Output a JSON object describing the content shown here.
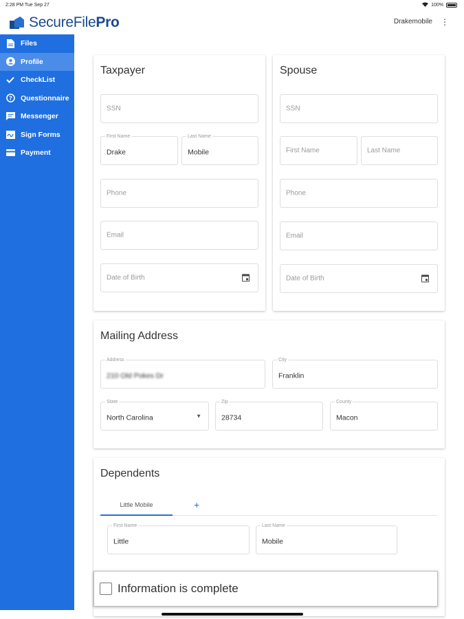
{
  "status_bar": {
    "time": "2:28 PM  Tue Sep 27",
    "battery": "100%"
  },
  "header": {
    "logo_main": "SecureFile",
    "logo_bold": "Pro",
    "username": "Drakemobile",
    "menu_glyph": "⋮"
  },
  "sidebar": {
    "items": [
      {
        "label": "Files",
        "icon": "file-icon",
        "active": false
      },
      {
        "label": "Profile",
        "icon": "account-icon",
        "active": true
      },
      {
        "label": "CheckList",
        "icon": "check-icon",
        "active": false
      },
      {
        "label": "Questionnaire",
        "icon": "help-circle-icon",
        "active": false
      },
      {
        "label": "Messenger",
        "icon": "chat-icon",
        "active": false
      },
      {
        "label": "Sign Forms",
        "icon": "sign-icon",
        "active": false
      },
      {
        "label": "Payment",
        "icon": "credit-card-icon",
        "active": false
      }
    ]
  },
  "taxpayer": {
    "title": "Taxpayer",
    "ssn_placeholder": "SSN",
    "first_name_label": "First Name",
    "first_name_value": "Drake",
    "last_name_label": "Last Name",
    "last_name_value": "Mobile",
    "phone_placeholder": "Phone",
    "email_placeholder": "Email",
    "dob_placeholder": "Date of Birth"
  },
  "spouse": {
    "title": "Spouse",
    "ssn_placeholder": "SSN",
    "first_name_placeholder": "First Name",
    "last_name_placeholder": "Last Name",
    "phone_placeholder": "Phone",
    "email_placeholder": "Email",
    "dob_placeholder": "Date of Birth"
  },
  "mailing": {
    "title": "Mailing Address",
    "address_label": "Address",
    "address_value": "210 Old Pokes Dr",
    "city_label": "City",
    "city_value": "Franklin",
    "state_label": "State",
    "state_value": "North Carolina",
    "zip_label": "Zip",
    "zip_value": "28734",
    "county_label": "County",
    "county_value": "Macon"
  },
  "dependents": {
    "title": "Dependents",
    "tabs": [
      "Little Mobile"
    ],
    "add_glyph": "+",
    "first_name_label": "First Name",
    "first_name_value": "Little",
    "last_name_label": "Last Name",
    "last_name_value": "Mobile"
  },
  "footer": {
    "complete_label": "Information is complete",
    "complete_checked": false
  },
  "colors": {
    "sidebar": "#1f6fe0",
    "sidebar_active": "#4a8ce8",
    "accent": "#2a6fd0",
    "logo": "#1a4a8e"
  }
}
